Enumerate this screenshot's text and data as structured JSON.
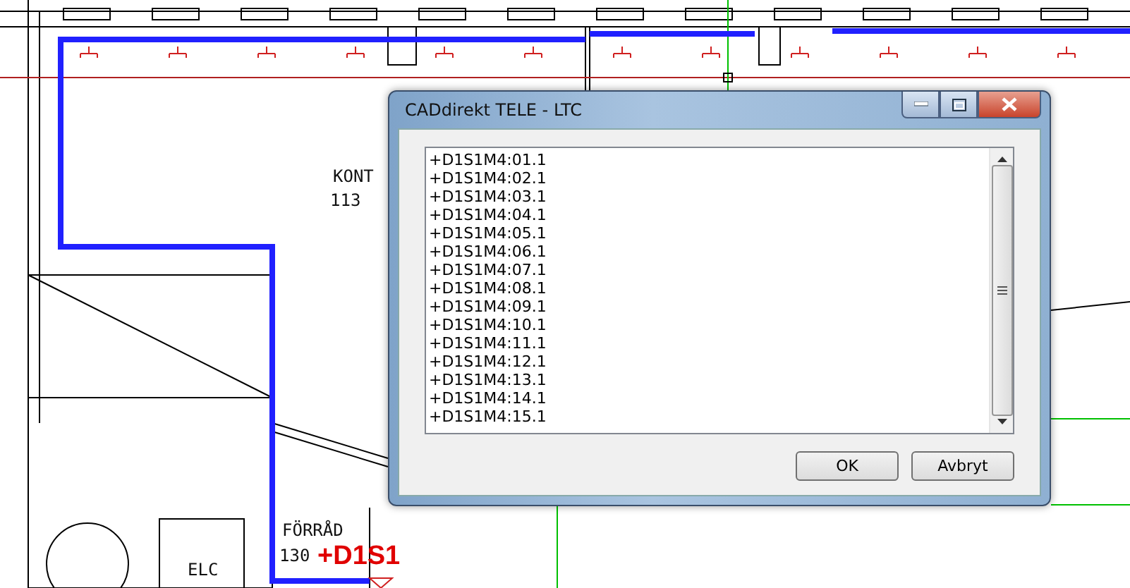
{
  "canvas_labels": [
    {
      "text": "KONT",
      "kind": "room"
    },
    {
      "text": "113",
      "kind": "room"
    },
    {
      "text": "FÖRRÅD",
      "kind": "room"
    },
    {
      "text": "130",
      "kind": "room"
    },
    {
      "text": "+D1S1",
      "kind": "tag"
    },
    {
      "text": "ELC",
      "kind": "room"
    }
  ],
  "dialog": {
    "title": "CADdirekt TELE - LTC",
    "items": [
      "+D1S1M4:01.1",
      "+D1S1M4:02.1",
      "+D1S1M4:03.1",
      "+D1S1M4:04.1",
      "+D1S1M4:05.1",
      "+D1S1M4:06.1",
      "+D1S1M4:07.1",
      "+D1S1M4:08.1",
      "+D1S1M4:09.1",
      "+D1S1M4:10.1",
      "+D1S1M4:11.1",
      "+D1S1M4:12.1",
      "+D1S1M4:13.1",
      "+D1S1M4:14.1",
      "+D1S1M4:15.1"
    ],
    "buttons": [
      "OK",
      "Avbryt"
    ]
  }
}
